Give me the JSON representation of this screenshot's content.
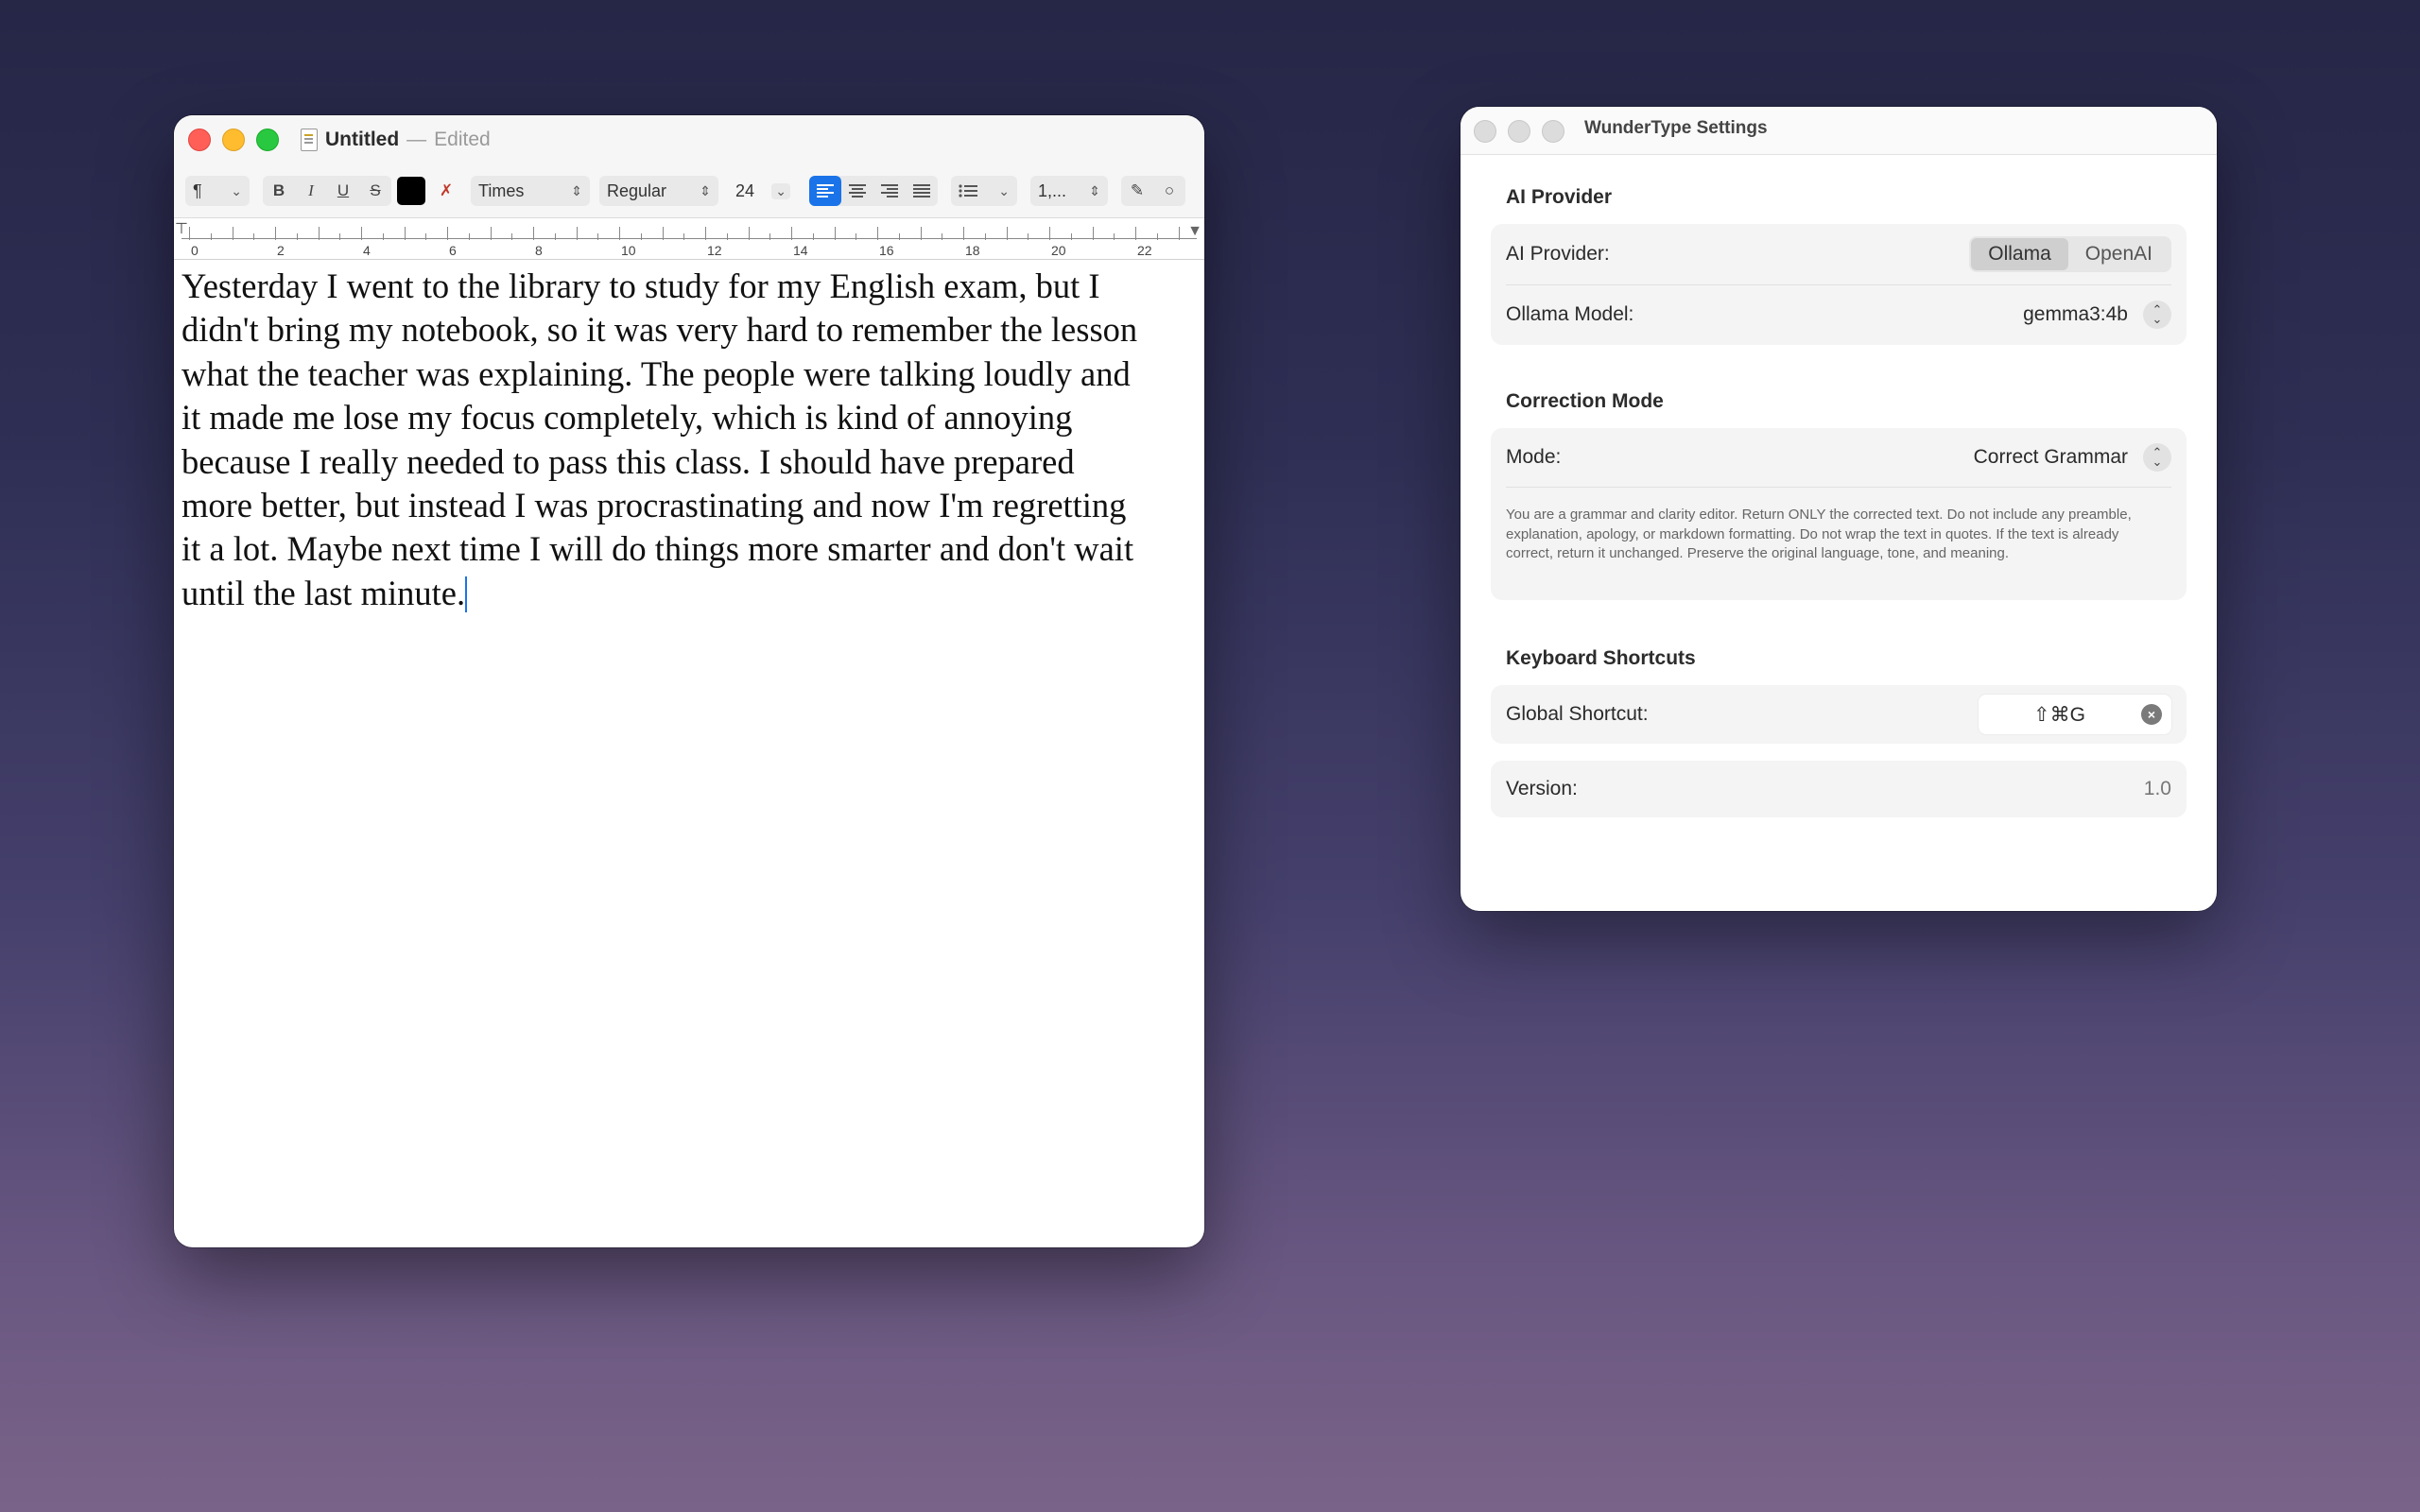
{
  "textedit": {
    "title": "Untitled",
    "title_sep": "—",
    "status": "Edited",
    "toolbar": {
      "paragraph_style": "¶",
      "bold": "B",
      "italic": "I",
      "underline": "U",
      "strike": "S",
      "font_family": "Times",
      "font_style": "Regular",
      "font_size": "24",
      "list_spacing": "1,..."
    },
    "ruler_numbers": [
      "0",
      "2",
      "4",
      "6",
      "8",
      "10",
      "12",
      "14",
      "16",
      "18",
      "20",
      "22"
    ],
    "body_lines": [
      "Yesterday I went to the library to study for my English exam, but I",
      "didn't bring my notebook, so it was very hard to remember the lesson",
      "what the teacher was explaining. The people were talking loudly and",
      "it made me lose my focus completely, which is kind of annoying",
      "because I really needed to pass this class. I should have prepared",
      "more better, but instead I was procrastinating and now I'm regretting",
      "it a lot. Maybe next time I will do things more smarter and don't wait",
      "until the last minute."
    ]
  },
  "settings": {
    "title": "WunderType Settings",
    "ai_provider": {
      "section_title": "AI Provider",
      "provider_label": "AI Provider:",
      "options": [
        "Ollama",
        "OpenAI"
      ],
      "selected": "Ollama",
      "model_label": "Ollama Model:",
      "model_value": "gemma3:4b"
    },
    "correction": {
      "section_title": "Correction Mode",
      "mode_label": "Mode:",
      "mode_value": "Correct Grammar",
      "prompt": "You are a grammar and clarity editor. Return ONLY the corrected text. Do not include any preamble, explanation, apology, or markdown formatting. Do not wrap the text in quotes. If the text is already correct, return it unchanged. Preserve the original language, tone, and meaning."
    },
    "shortcuts": {
      "section_title": "Keyboard Shortcuts",
      "global_label": "Global Shortcut:",
      "global_value": "⇧⌘G"
    },
    "version": {
      "label": "Version:",
      "value": "1.0"
    }
  }
}
